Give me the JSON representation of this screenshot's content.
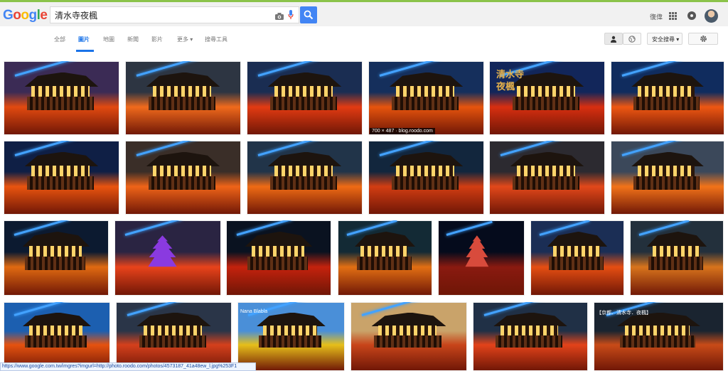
{
  "header": {
    "logo_text": "Google",
    "logo_colors": [
      "#4285f4",
      "#ea4335",
      "#fbbc05",
      "#4285f4",
      "#34a853",
      "#ea4335"
    ],
    "search_query": "清水寺夜楓",
    "account_label": "復偉"
  },
  "nav": {
    "tabs": [
      "全部",
      "圖片",
      "地圖",
      "新聞",
      "影片",
      "更多 ▾",
      "搜尋工具"
    ],
    "active_tab": "圖片",
    "safe_search_label": "安全搜尋 ▾"
  },
  "images": [
    {
      "row": 0,
      "bg": "#3b2b55",
      "fg": "#e24a10",
      "caption": "",
      "overlay": ""
    },
    {
      "row": 0,
      "bg": "#2d3542",
      "fg": "#f06a1c",
      "caption": "",
      "overlay": ""
    },
    {
      "row": 0,
      "bg": "#1a2d52",
      "fg": "#e33b12",
      "caption": "",
      "overlay": ""
    },
    {
      "row": 0,
      "bg": "#152f5c",
      "fg": "#e6540d",
      "caption": "700 × 487 · blog.roodo.com",
      "overlay": ""
    },
    {
      "row": 0,
      "bg": "#12265a",
      "fg": "#d82f10",
      "caption": "",
      "overlay": "清水寺\n夜楓"
    },
    {
      "row": 0,
      "bg": "#102c5e",
      "fg": "#ee5712",
      "caption": "",
      "overlay": ""
    },
    {
      "row": 1,
      "bg": "#0f1f45",
      "fg": "#e9540f",
      "caption": "",
      "overlay": ""
    },
    {
      "row": 1,
      "bg": "#3a2e28",
      "fg": "#ef6418",
      "caption": "",
      "overlay": ""
    },
    {
      "row": 1,
      "bg": "#213449",
      "fg": "#ef6b14",
      "caption": "",
      "overlay": ""
    },
    {
      "row": 1,
      "bg": "#12263d",
      "fg": "#d23d12",
      "caption": "",
      "overlay": ""
    },
    {
      "row": 1,
      "bg": "#2c2a30",
      "fg": "#e2481a",
      "caption": "",
      "overlay": ""
    },
    {
      "row": 1,
      "bg": "#3b485a",
      "fg": "#f27319",
      "caption": "",
      "overlay": ""
    },
    {
      "row": 2,
      "bg": "#0c1a30",
      "fg": "#e06a11",
      "caption": "",
      "overlay": ""
    },
    {
      "row": 2,
      "bg": "#2a2442",
      "fg": "#e8431b",
      "caption": "",
      "overlay": "",
      "pagoda": "purple"
    },
    {
      "row": 2,
      "bg": "#0a1220",
      "fg": "#c4220d",
      "caption": "",
      "overlay": ""
    },
    {
      "row": 2,
      "bg": "#132a35",
      "fg": "#e26f13",
      "caption": "",
      "overlay": ""
    },
    {
      "row": 2,
      "bg": "#050b1c",
      "fg": "#8a1a10",
      "caption": "",
      "overlay": "",
      "pagoda": "red"
    },
    {
      "row": 2,
      "bg": "#1b2e55",
      "fg": "#e54e12",
      "caption": "",
      "overlay": ""
    },
    {
      "row": 2,
      "bg": "#23303c",
      "fg": "#d8741c",
      "caption": "",
      "overlay": ""
    },
    {
      "row": 3,
      "bg": "#1c5fb0",
      "fg": "#e5520f",
      "caption": "",
      "overlay": ""
    },
    {
      "row": 3,
      "bg": "#2a3548",
      "fg": "#d4401c",
      "caption": "",
      "overlay": ""
    },
    {
      "row": 3,
      "bg": "#4a8fd8",
      "fg": "#e6bf1a",
      "caption": "",
      "overlay": "Nana Blabla"
    },
    {
      "row": 3,
      "bg": "#c9a36a",
      "fg": "#c8451a",
      "caption": "",
      "overlay": ""
    },
    {
      "row": 3,
      "bg": "#203046",
      "fg": "#e2431a",
      "caption": "",
      "overlay": ""
    },
    {
      "row": 3,
      "bg": "#1a2430",
      "fg": "#c84b18",
      "caption": "",
      "overlay": "【京都．清水寺．夜楓】"
    }
  ],
  "status_url": "https://www.google.com.tw/imgres?imgurl=http://photo.roodo.com/photos/4573187_41a48ew_l.jpg%253F1"
}
